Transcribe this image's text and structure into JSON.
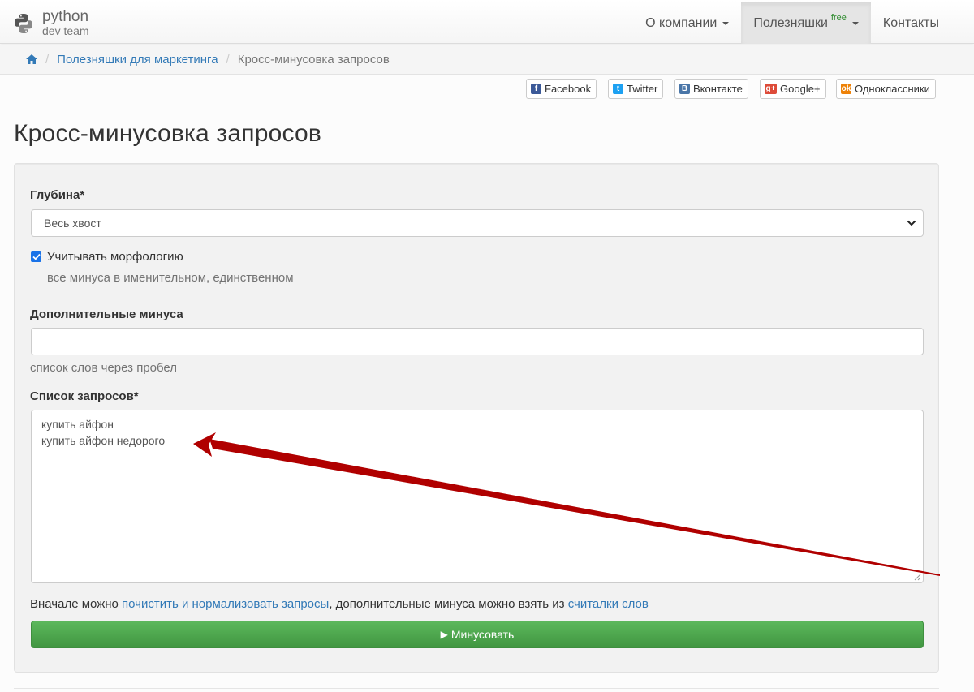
{
  "brand": {
    "line1": "python",
    "line2": "dev team"
  },
  "nav": {
    "items": [
      {
        "label": "О компании",
        "dropdown": true
      },
      {
        "label": "Полезняшки",
        "badge": "free",
        "dropdown": true,
        "active": true
      },
      {
        "label": "Контакты",
        "dropdown": false
      }
    ]
  },
  "breadcrumb": {
    "home_icon": "home-icon",
    "items": [
      "Полезняшки для маркетинга"
    ],
    "current": "Кросс-минусовка запросов"
  },
  "share": [
    {
      "label": "Facebook",
      "icon": "facebook-icon",
      "color": "#3b5998"
    },
    {
      "label": "Twitter",
      "icon": "twitter-icon",
      "color": "#1da1f2"
    },
    {
      "label": "Вконтакте",
      "icon": "vk-icon",
      "color": "#4a76a8"
    },
    {
      "label": "Google+",
      "icon": "google-plus-icon",
      "color": "#dd4b39"
    },
    {
      "label": "Одноклассники",
      "icon": "odnoklassniki-icon",
      "color": "#ee8208"
    }
  ],
  "page": {
    "title": "Кросс-минусовка запросов"
  },
  "form": {
    "depth": {
      "label": "Глубина*",
      "value": "Весь хвост"
    },
    "morphology": {
      "label": "Учитывать морфологию",
      "checked": true,
      "help": "все минуса в именительном, единственном"
    },
    "extra": {
      "label": "Дополнительные минуса",
      "value": "",
      "help": "список слов через пробел"
    },
    "queries": {
      "label": "Список запросов*",
      "value": "купить айфон\nкупить айфон недорого"
    },
    "note": {
      "prefix": "Вначале можно ",
      "link1": "почистить и нормализовать запросы",
      "middle": ", дополнительные минуса можно взять из ",
      "link2": "считалки слов"
    },
    "submit": {
      "icon": "▶",
      "label": "Минусовать"
    }
  },
  "colors": {
    "link": "#337ab7",
    "submit": "#5cb85c",
    "annotation_arrow": "#b00000",
    "free_badge": "#2e8b2e"
  }
}
